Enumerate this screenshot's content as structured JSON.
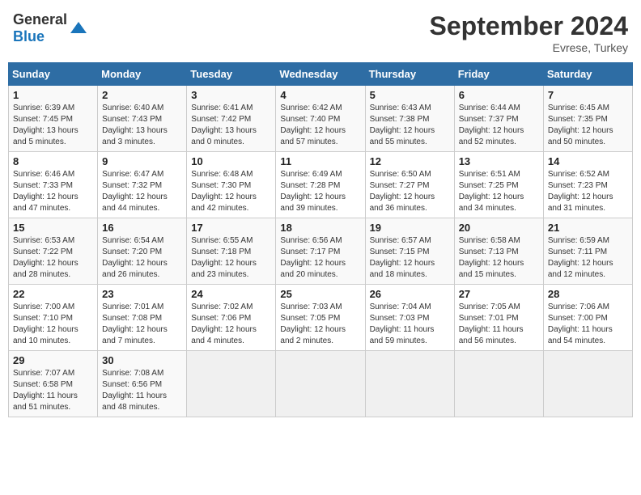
{
  "header": {
    "logo_general": "General",
    "logo_blue": "Blue",
    "title": "September 2024",
    "location": "Evrese, Turkey"
  },
  "days_of_week": [
    "Sunday",
    "Monday",
    "Tuesday",
    "Wednesday",
    "Thursday",
    "Friday",
    "Saturday"
  ],
  "weeks": [
    [
      {
        "day": "1",
        "sunrise": "Sunrise: 6:39 AM",
        "sunset": "Sunset: 7:45 PM",
        "daylight": "Daylight: 13 hours and 5 minutes."
      },
      {
        "day": "2",
        "sunrise": "Sunrise: 6:40 AM",
        "sunset": "Sunset: 7:43 PM",
        "daylight": "Daylight: 13 hours and 3 minutes."
      },
      {
        "day": "3",
        "sunrise": "Sunrise: 6:41 AM",
        "sunset": "Sunset: 7:42 PM",
        "daylight": "Daylight: 13 hours and 0 minutes."
      },
      {
        "day": "4",
        "sunrise": "Sunrise: 6:42 AM",
        "sunset": "Sunset: 7:40 PM",
        "daylight": "Daylight: 12 hours and 57 minutes."
      },
      {
        "day": "5",
        "sunrise": "Sunrise: 6:43 AM",
        "sunset": "Sunset: 7:38 PM",
        "daylight": "Daylight: 12 hours and 55 minutes."
      },
      {
        "day": "6",
        "sunrise": "Sunrise: 6:44 AM",
        "sunset": "Sunset: 7:37 PM",
        "daylight": "Daylight: 12 hours and 52 minutes."
      },
      {
        "day": "7",
        "sunrise": "Sunrise: 6:45 AM",
        "sunset": "Sunset: 7:35 PM",
        "daylight": "Daylight: 12 hours and 50 minutes."
      }
    ],
    [
      {
        "day": "8",
        "sunrise": "Sunrise: 6:46 AM",
        "sunset": "Sunset: 7:33 PM",
        "daylight": "Daylight: 12 hours and 47 minutes."
      },
      {
        "day": "9",
        "sunrise": "Sunrise: 6:47 AM",
        "sunset": "Sunset: 7:32 PM",
        "daylight": "Daylight: 12 hours and 44 minutes."
      },
      {
        "day": "10",
        "sunrise": "Sunrise: 6:48 AM",
        "sunset": "Sunset: 7:30 PM",
        "daylight": "Daylight: 12 hours and 42 minutes."
      },
      {
        "day": "11",
        "sunrise": "Sunrise: 6:49 AM",
        "sunset": "Sunset: 7:28 PM",
        "daylight": "Daylight: 12 hours and 39 minutes."
      },
      {
        "day": "12",
        "sunrise": "Sunrise: 6:50 AM",
        "sunset": "Sunset: 7:27 PM",
        "daylight": "Daylight: 12 hours and 36 minutes."
      },
      {
        "day": "13",
        "sunrise": "Sunrise: 6:51 AM",
        "sunset": "Sunset: 7:25 PM",
        "daylight": "Daylight: 12 hours and 34 minutes."
      },
      {
        "day": "14",
        "sunrise": "Sunrise: 6:52 AM",
        "sunset": "Sunset: 7:23 PM",
        "daylight": "Daylight: 12 hours and 31 minutes."
      }
    ],
    [
      {
        "day": "15",
        "sunrise": "Sunrise: 6:53 AM",
        "sunset": "Sunset: 7:22 PM",
        "daylight": "Daylight: 12 hours and 28 minutes."
      },
      {
        "day": "16",
        "sunrise": "Sunrise: 6:54 AM",
        "sunset": "Sunset: 7:20 PM",
        "daylight": "Daylight: 12 hours and 26 minutes."
      },
      {
        "day": "17",
        "sunrise": "Sunrise: 6:55 AM",
        "sunset": "Sunset: 7:18 PM",
        "daylight": "Daylight: 12 hours and 23 minutes."
      },
      {
        "day": "18",
        "sunrise": "Sunrise: 6:56 AM",
        "sunset": "Sunset: 7:17 PM",
        "daylight": "Daylight: 12 hours and 20 minutes."
      },
      {
        "day": "19",
        "sunrise": "Sunrise: 6:57 AM",
        "sunset": "Sunset: 7:15 PM",
        "daylight": "Daylight: 12 hours and 18 minutes."
      },
      {
        "day": "20",
        "sunrise": "Sunrise: 6:58 AM",
        "sunset": "Sunset: 7:13 PM",
        "daylight": "Daylight: 12 hours and 15 minutes."
      },
      {
        "day": "21",
        "sunrise": "Sunrise: 6:59 AM",
        "sunset": "Sunset: 7:11 PM",
        "daylight": "Daylight: 12 hours and 12 minutes."
      }
    ],
    [
      {
        "day": "22",
        "sunrise": "Sunrise: 7:00 AM",
        "sunset": "Sunset: 7:10 PM",
        "daylight": "Daylight: 12 hours and 10 minutes."
      },
      {
        "day": "23",
        "sunrise": "Sunrise: 7:01 AM",
        "sunset": "Sunset: 7:08 PM",
        "daylight": "Daylight: 12 hours and 7 minutes."
      },
      {
        "day": "24",
        "sunrise": "Sunrise: 7:02 AM",
        "sunset": "Sunset: 7:06 PM",
        "daylight": "Daylight: 12 hours and 4 minutes."
      },
      {
        "day": "25",
        "sunrise": "Sunrise: 7:03 AM",
        "sunset": "Sunset: 7:05 PM",
        "daylight": "Daylight: 12 hours and 2 minutes."
      },
      {
        "day": "26",
        "sunrise": "Sunrise: 7:04 AM",
        "sunset": "Sunset: 7:03 PM",
        "daylight": "Daylight: 11 hours and 59 minutes."
      },
      {
        "day": "27",
        "sunrise": "Sunrise: 7:05 AM",
        "sunset": "Sunset: 7:01 PM",
        "daylight": "Daylight: 11 hours and 56 minutes."
      },
      {
        "day": "28",
        "sunrise": "Sunrise: 7:06 AM",
        "sunset": "Sunset: 7:00 PM",
        "daylight": "Daylight: 11 hours and 54 minutes."
      }
    ],
    [
      {
        "day": "29",
        "sunrise": "Sunrise: 7:07 AM",
        "sunset": "Sunset: 6:58 PM",
        "daylight": "Daylight: 11 hours and 51 minutes."
      },
      {
        "day": "30",
        "sunrise": "Sunrise: 7:08 AM",
        "sunset": "Sunset: 6:56 PM",
        "daylight": "Daylight: 11 hours and 48 minutes."
      },
      null,
      null,
      null,
      null,
      null
    ]
  ]
}
